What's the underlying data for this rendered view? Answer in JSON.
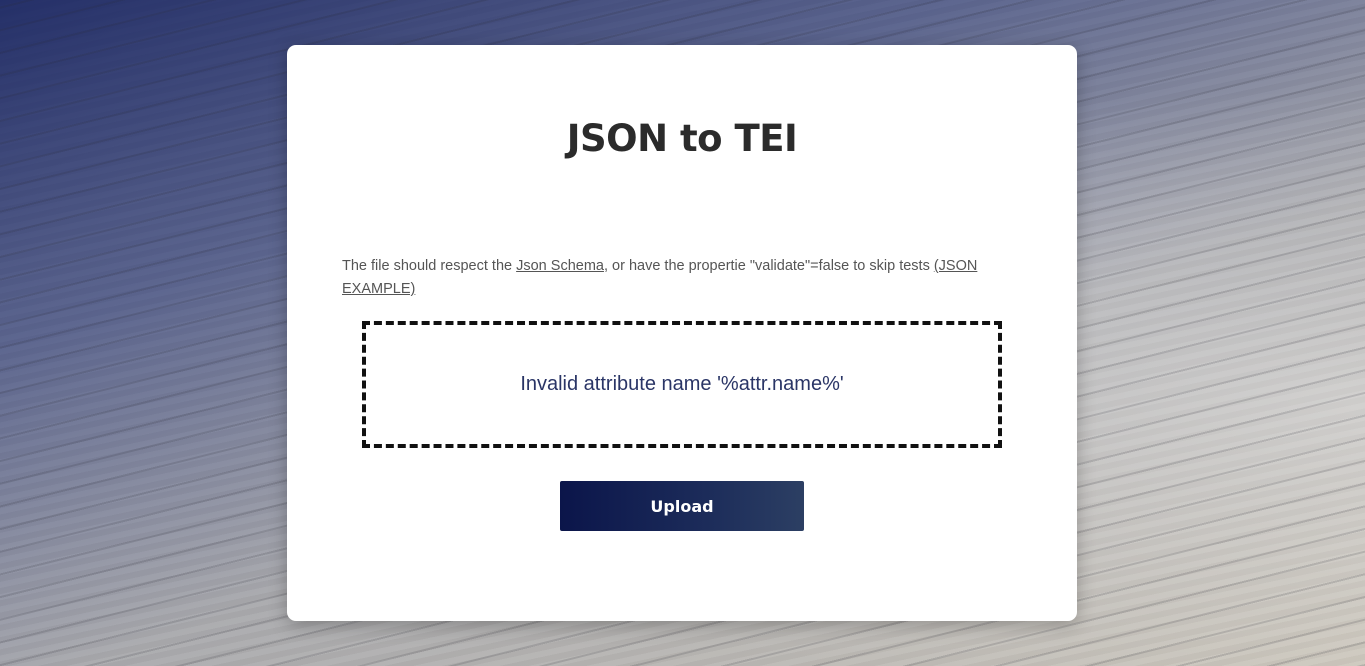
{
  "app": {
    "title": "JSON to TEI"
  },
  "info": {
    "text_before": "The file should respect the ",
    "schema_link": "Json Schema",
    "text_middle": ", or have the propertie \"validate\"=false to skip tests ",
    "example_link": "(JSON EXAMPLE)"
  },
  "dropzone": {
    "message": "Invalid attribute name '%attr.name%'"
  },
  "actions": {
    "upload_label": "Upload"
  },
  "colors": {
    "button_start": "#0b154a",
    "button_end": "#2c3f63",
    "message_text": "#2a3566",
    "title_text": "#2b2b2b"
  }
}
